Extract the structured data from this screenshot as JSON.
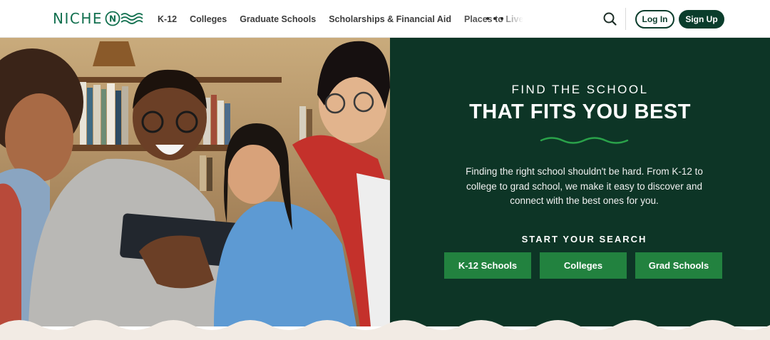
{
  "brand": {
    "name": "NICHE",
    "mark_letter": "N",
    "accent": "#12704f"
  },
  "nav": {
    "links": [
      "K-12",
      "Colleges",
      "Graduate Schools",
      "Scholarships & Financial Aid",
      "Places to Live"
    ],
    "more_icon": "more-horizontal-icon",
    "search_icon": "search-icon",
    "login_label": "Log In",
    "signup_label": "Sign Up"
  },
  "hero": {
    "eyebrow": "FIND THE SCHOOL",
    "headline": "THAT FITS YOU BEST",
    "description": "Finding the right school shouldn't be hard. From K-12 to college to grad school, we make it easy to discover and connect with the best ones for you.",
    "search_label": "START YOUR SEARCH",
    "buttons": [
      "K-12 Schools",
      "Colleges",
      "Grad Schools"
    ],
    "panel_color": "#0d3526",
    "button_color": "#22823f"
  }
}
